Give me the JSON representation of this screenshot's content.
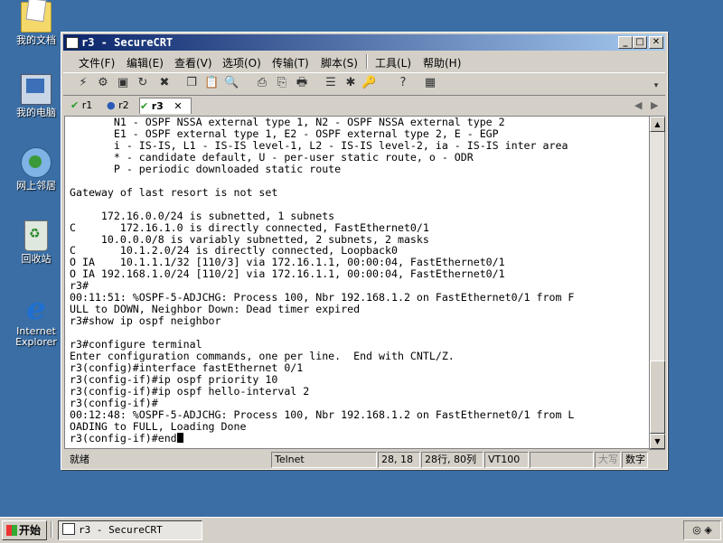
{
  "desktop": {
    "icons": [
      {
        "label": "我的文档",
        "icon": "my-documents-icon"
      },
      {
        "label": "我的电脑",
        "icon": "my-computer-icon"
      },
      {
        "label": "网上邻居",
        "icon": "network-places-icon"
      },
      {
        "label": "回收站",
        "icon": "recycle-bin-icon"
      },
      {
        "label": "Internet Explorer",
        "icon": "internet-explorer-icon"
      }
    ]
  },
  "window": {
    "title": "r3 - SecureCRT",
    "menu": [
      "文件(F)",
      "编辑(E)",
      "查看(V)",
      "选项(O)",
      "传输(T)",
      "脚本(S)",
      "工具(L)",
      "帮助(H)"
    ],
    "tabs": [
      {
        "label": "r1",
        "status": "connected"
      },
      {
        "label": "r2",
        "status": "disconnected"
      },
      {
        "label": "r3",
        "status": "connected",
        "close": "✕"
      }
    ],
    "terminal_lines": [
      "       N1 - OSPF NSSA external type 1, N2 - OSPF NSSA external type 2",
      "       E1 - OSPF external type 1, E2 - OSPF external type 2, E - EGP",
      "       i - IS-IS, L1 - IS-IS level-1, L2 - IS-IS level-2, ia - IS-IS inter area",
      "       * - candidate default, U - per-user static route, o - ODR",
      "       P - periodic downloaded static route",
      "",
      "Gateway of last resort is not set",
      "",
      "     172.16.0.0/24 is subnetted, 1 subnets",
      "C       172.16.1.0 is directly connected, FastEthernet0/1",
      "     10.0.0.0/8 is variably subnetted, 2 subnets, 2 masks",
      "C       10.1.2.0/24 is directly connected, Loopback0",
      "O IA    10.1.1.1/32 [110/3] via 172.16.1.1, 00:00:04, FastEthernet0/1",
      "O IA 192.168.1.0/24 [110/2] via 172.16.1.1, 00:00:04, FastEthernet0/1",
      "r3#",
      "00:11:51: %OSPF-5-ADJCHG: Process 100, Nbr 192.168.1.2 on FastEthernet0/1 from F",
      "ULL to DOWN, Neighbor Down: Dead timer expired",
      "r3#show ip ospf neighbor",
      "",
      "r3#configure terminal",
      "Enter configuration commands, one per line.  End with CNTL/Z.",
      "r3(config)#interface fastEthernet 0/1",
      "r3(config-if)#ip ospf priority 10",
      "r3(config-if)#ip ospf hello-interval 2",
      "r3(config-if)#",
      "00:12:48: %OSPF-5-ADJCHG: Process 100, Nbr 192.168.1.2 on FastEthernet0/1 from L",
      "OADING to FULL, Loading Done",
      "r3(config-if)#end"
    ],
    "status": {
      "ready": "就绪",
      "protocol": "Telnet",
      "cursor": "28, 18",
      "size": "28行, 80列",
      "emulation": "VT100",
      "caps": "大写",
      "num": "数字"
    }
  },
  "taskbar": {
    "start_label": "开始",
    "task_item": "r3 - SecureCRT"
  }
}
